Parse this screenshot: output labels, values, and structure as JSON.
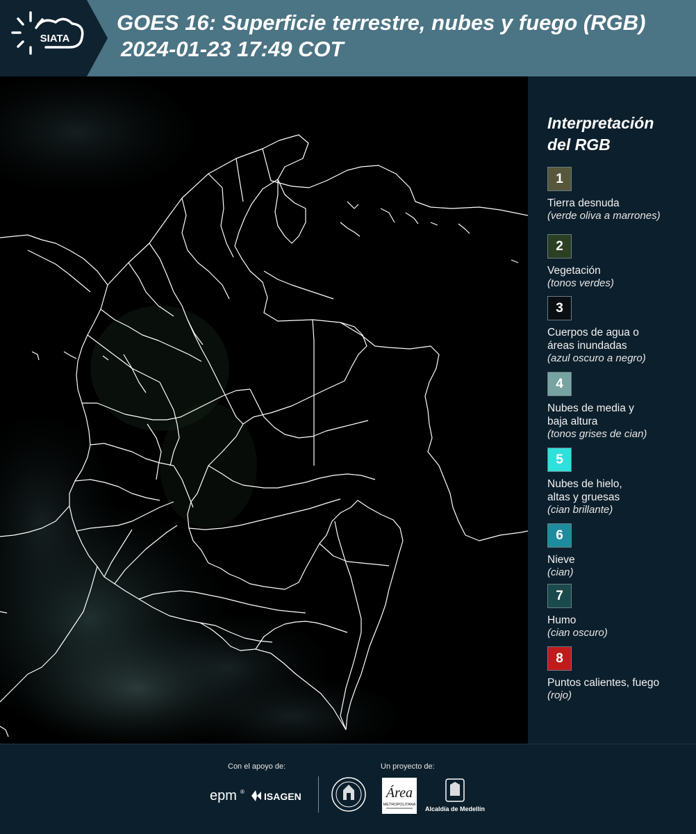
{
  "header": {
    "logo_text": "SIATA",
    "title_line1": "GOES 16: Superficie terrestre, nubes y fuego (RGB)",
    "title_line2": "2024-01-23 17:49 COT"
  },
  "legend": {
    "title_line1": "Interpretación",
    "title_line2": "del RGB",
    "items": [
      {
        "num": "1",
        "color": "#56573c",
        "label": [
          "Tierra desnuda"
        ],
        "desc": "(verde oliva a marrones)"
      },
      {
        "num": "2",
        "color": "#2b3f22",
        "label": [
          "Vegetación"
        ],
        "desc": "(tonos verdes)"
      },
      {
        "num": "3",
        "color": "#0a0f14",
        "label": [
          "Cuerpos de agua o",
          "áreas inundadas"
        ],
        "desc": "(azul oscuro a negro)"
      },
      {
        "num": "4",
        "color": "#77a3a2",
        "label": [
          "Nubes de media y",
          "baja altura"
        ],
        "desc": "(tonos grises de cian)"
      },
      {
        "num": "5",
        "color": "#2fe0dc",
        "label": [
          "Nubes de hielo,",
          "altas y gruesas"
        ],
        "desc": "(cian brillante)"
      },
      {
        "num": "6",
        "color": "#1e8c9e",
        "label": [
          "Nieve"
        ],
        "desc": "(cian)"
      },
      {
        "num": "7",
        "color": "#1b4a4c",
        "label": [
          "Humo"
        ],
        "desc": "(cian oscuro)"
      },
      {
        "num": "8",
        "color": "#c01b1b",
        "label": [
          "Puntos calientes, fuego"
        ],
        "desc": "(rojo)"
      }
    ]
  },
  "footer": {
    "support_label": "Con el apoyo de:",
    "project_label": "Un proyecto de:",
    "logos": {
      "epm": "epm",
      "isagen": "ISAGEN",
      "metro_main": "Área",
      "metro_sub": "METROPOLITANA",
      "alcaldia": "Alcaldía de Medellín"
    }
  }
}
